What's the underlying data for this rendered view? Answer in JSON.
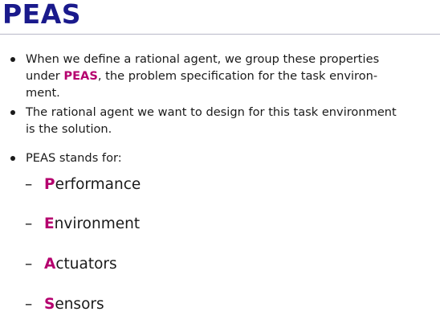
{
  "slide": {
    "title": "PEAS",
    "bullets": [
      {
        "line1": "When we define a rational agent, we group these properties",
        "line2_before": "under ",
        "line2_keyword": "PEAS",
        "line2_after": ", the problem specification for the task environ-",
        "line3": "ment."
      },
      {
        "line1": "The rational agent we want to design for this task environment",
        "line2": "is the solution."
      },
      {
        "line1": "PEAS stands for:"
      }
    ],
    "sub_items": [
      {
        "dash": "–",
        "initial": "P",
        "rest": "erformance"
      },
      {
        "dash": "–",
        "initial": "E",
        "rest": "nvironment"
      },
      {
        "dash": "–",
        "initial": "A",
        "rest": "ctuators"
      },
      {
        "dash": "–",
        "initial": "S",
        "rest": "ensors"
      }
    ],
    "colors": {
      "title": "#1a1a8c",
      "keyword": "#b5006e"
    }
  }
}
